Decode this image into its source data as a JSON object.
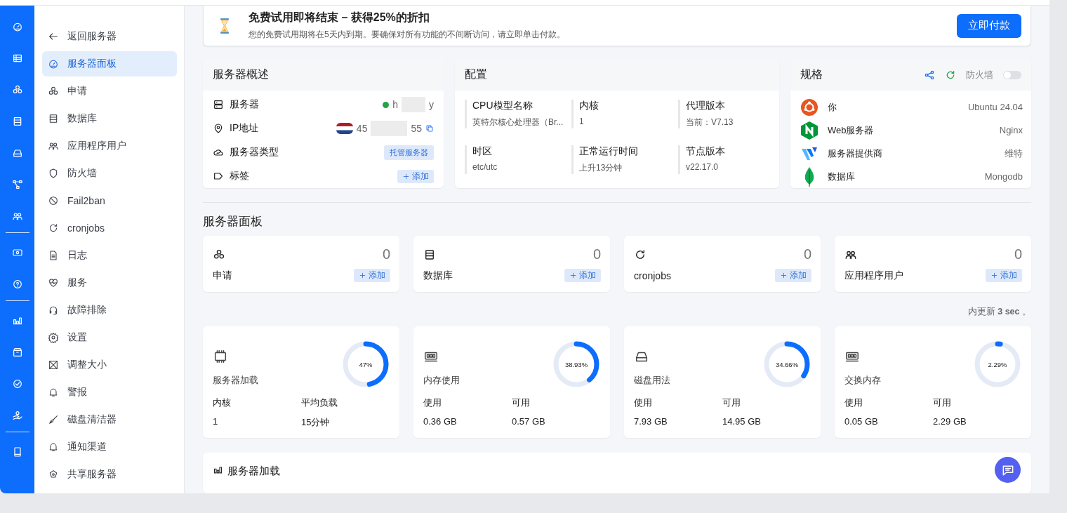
{
  "banner": {
    "title": "免费试用即将结束 – 获得25%的折扣",
    "message": "您的免费试用期将在5天内到期。要确保对所有功能的不间断访问，请立即单击付款。",
    "button": "立即付款"
  },
  "sidebar": {
    "items": [
      {
        "label": "返回服务器",
        "selected": false
      },
      {
        "label": "服务器面板",
        "selected": true
      },
      {
        "label": "申请",
        "selected": false
      },
      {
        "label": "数据库",
        "selected": false
      },
      {
        "label": "应用程序用户",
        "selected": false
      },
      {
        "label": "防火墙",
        "selected": false
      },
      {
        "label": "Fail2ban",
        "selected": false
      },
      {
        "label": "cronjobs",
        "selected": false
      },
      {
        "label": "日志",
        "selected": false
      },
      {
        "label": "服务",
        "selected": false
      },
      {
        "label": "故障排除",
        "selected": false
      },
      {
        "label": "设置",
        "selected": false
      },
      {
        "label": "调整大小",
        "selected": false
      },
      {
        "label": "警报",
        "selected": false
      },
      {
        "label": "磁盘清洁器",
        "selected": false
      },
      {
        "label": "通知渠道",
        "selected": false
      },
      {
        "label": "共享服务器",
        "selected": false
      }
    ]
  },
  "overview": {
    "title": "服务器概述",
    "rows": [
      {
        "kind": "server",
        "label": "服务器",
        "color": "#22a447",
        "value_parts": [
          "h",
          "y"
        ]
      },
      {
        "kind": "ip",
        "label": "IP地址",
        "value_parts": [
          "45",
          "55"
        ]
      },
      {
        "kind": "tag",
        "label": "服务器类型",
        "value": "托管服务器"
      },
      {
        "kind": "add",
        "label": "标签",
        "value": "添加"
      }
    ]
  },
  "config": {
    "title": "配置",
    "items": [
      {
        "label": "CPU模型名称",
        "value": "英特尔核心处理器（Br..."
      },
      {
        "label": "内核",
        "value": "1"
      },
      {
        "label": "代理版本",
        "value": "当前：V7.13"
      },
      {
        "label": "时区",
        "value": "etc/utc"
      },
      {
        "label": "正常运行时间",
        "value": "上升13分钟"
      },
      {
        "label": "节点版本",
        "value": "v22.17.0"
      }
    ]
  },
  "specs": {
    "title": "规格",
    "firewall_label": "防火墙",
    "firewall_on": false,
    "rows": [
      {
        "label": "你",
        "value": "Ubuntu 24.04"
      },
      {
        "label": "Web服务器",
        "value": "Nginx"
      },
      {
        "label": "服务器提供商",
        "value": "维特"
      },
      {
        "label": "数据库",
        "value": "Mongodb"
      }
    ]
  },
  "section_title": "服务器面板",
  "counts": [
    {
      "label": "申请",
      "count": "0",
      "action": "添加"
    },
    {
      "label": "数据库",
      "count": "0",
      "action": "添加"
    },
    {
      "label": "cronjobs",
      "count": "0",
      "action": "添加"
    },
    {
      "label": "应用程序用户",
      "count": "0",
      "action": "添加"
    }
  ],
  "update_note": "内更新 **3 sec** 。",
  "metrics": [
    {
      "title": "服务器加载",
      "reading": "47%",
      "level": 0.47,
      "stats": [
        {
          "label": "内核",
          "value": "1"
        },
        {
          "label": "平均负载",
          "value": "15分钟"
        }
      ]
    },
    {
      "title": "内存使用",
      "reading": "38.93%",
      "level": 0.3893,
      "stats": [
        {
          "label": "使用",
          "value": "0.36 GB"
        },
        {
          "label": "可用",
          "value": "0.57 GB"
        }
      ]
    },
    {
      "title": "磁盘用法",
      "reading": "34.66%",
      "level": 0.3466,
      "stats": [
        {
          "label": "使用",
          "value": "7.93 GB"
        },
        {
          "label": "可用",
          "value": "14.95 GB"
        }
      ]
    },
    {
      "title": "交换内存",
      "reading": "2.29%",
      "level": 0.0229,
      "stats": [
        {
          "label": "使用",
          "value": "0.05 GB"
        },
        {
          "label": "可用",
          "value": "2.29 GB"
        }
      ]
    }
  ],
  "chart_card": {
    "title": "服务器加载"
  }
}
